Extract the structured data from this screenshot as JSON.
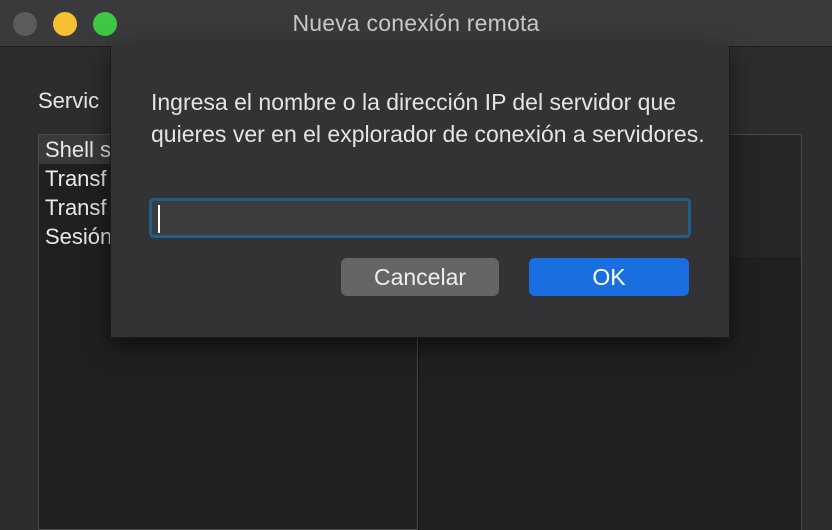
{
  "window": {
    "title": "Nueva conexión remota"
  },
  "background": {
    "section_label": "Servic",
    "list_items": [
      {
        "label": "Shell s"
      },
      {
        "label": "Transf"
      },
      {
        "label": "Transf"
      },
      {
        "label": "Sesión"
      }
    ]
  },
  "dialog": {
    "prompt": "Ingresa el nombre o la dirección IP del servidor que quieres ver en el explorador de conexión a servidores.",
    "input_value": "",
    "input_placeholder": "",
    "cancel_label": "Cancelar",
    "ok_label": "OK"
  },
  "colors": {
    "accent": "#1a6fe0",
    "focus_ring": "#1e5f88",
    "close": "#5c5c5e",
    "minimize": "#f5c033",
    "maximize": "#3ec743"
  }
}
